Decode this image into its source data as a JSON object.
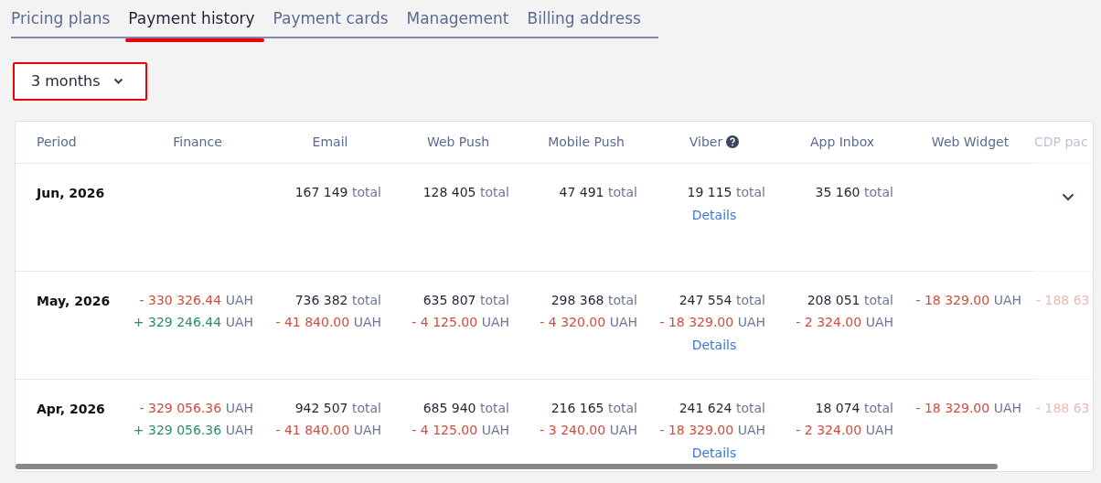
{
  "tabs": [
    {
      "label": "Pricing plans",
      "selected": false
    },
    {
      "label": "Payment history",
      "selected": true
    },
    {
      "label": "Payment cards",
      "selected": false
    },
    {
      "label": "Management",
      "selected": false
    },
    {
      "label": "Billing address",
      "selected": false
    }
  ],
  "period_select": {
    "value": "3 months"
  },
  "table": {
    "columns": [
      {
        "label": "Period"
      },
      {
        "label": "Finance"
      },
      {
        "label": "Email"
      },
      {
        "label": "Web Push"
      },
      {
        "label": "Mobile Push"
      },
      {
        "label": "Viber",
        "help": true
      },
      {
        "label": "App Inbox"
      },
      {
        "label": "Web Widget"
      },
      {
        "label": "CDP pac",
        "cut": true
      }
    ],
    "rows": [
      {
        "show_toggle": true,
        "cells": [
          "Jun, 2026",
          "",
          [
            {
              "kind": "total",
              "value": "167 149",
              "unit": "total"
            }
          ],
          [
            {
              "kind": "total",
              "value": "128 405",
              "unit": "total"
            }
          ],
          [
            {
              "kind": "total",
              "value": "47 491",
              "unit": "total"
            }
          ],
          [
            {
              "kind": "total",
              "value": "19 115",
              "unit": "total"
            },
            {
              "kind": "link",
              "text": "Details"
            }
          ],
          [
            {
              "kind": "total",
              "value": "35 160",
              "unit": "total"
            }
          ],
          "",
          ""
        ]
      },
      {
        "show_toggle": false,
        "cells": [
          "May, 2026",
          [
            {
              "kind": "debit",
              "sign": "-",
              "value": "330 326.44",
              "unit": "UAH"
            },
            {
              "kind": "credit",
              "sign": "+",
              "value": "329 246.44",
              "unit": "UAH"
            }
          ],
          [
            {
              "kind": "total",
              "value": "736 382",
              "unit": "total"
            },
            {
              "kind": "debit",
              "sign": "-",
              "value": "41 840.00",
              "unit": "UAH"
            }
          ],
          [
            {
              "kind": "total",
              "value": "635 807",
              "unit": "total"
            },
            {
              "kind": "debit",
              "sign": "-",
              "value": "4 125.00",
              "unit": "UAH"
            }
          ],
          [
            {
              "kind": "total",
              "value": "298 368",
              "unit": "total"
            },
            {
              "kind": "debit",
              "sign": "-",
              "value": "4 320.00",
              "unit": "UAH"
            }
          ],
          [
            {
              "kind": "total",
              "value": "247 554",
              "unit": "total"
            },
            {
              "kind": "debit",
              "sign": "-",
              "value": "18 329.00",
              "unit": "UAH"
            },
            {
              "kind": "link",
              "text": "Details"
            }
          ],
          [
            {
              "kind": "total",
              "value": "208 051",
              "unit": "total"
            },
            {
              "kind": "debit",
              "sign": "-",
              "value": "2 324.00",
              "unit": "UAH"
            }
          ],
          [
            {
              "kind": "debit",
              "sign": "-",
              "value": "18 329.00",
              "unit": "UAH"
            }
          ],
          [
            {
              "kind": "debit",
              "sign": "-",
              "value": "188 63"
            }
          ]
        ]
      },
      {
        "show_toggle": false,
        "cells": [
          "Apr, 2026",
          [
            {
              "kind": "debit",
              "sign": "-",
              "value": "329 056.36",
              "unit": "UAH"
            },
            {
              "kind": "credit",
              "sign": "+",
              "value": "329 056.36",
              "unit": "UAH"
            }
          ],
          [
            {
              "kind": "total",
              "value": "942 507",
              "unit": "total"
            },
            {
              "kind": "debit",
              "sign": "-",
              "value": "41 840.00",
              "unit": "UAH"
            }
          ],
          [
            {
              "kind": "total",
              "value": "685 940",
              "unit": "total"
            },
            {
              "kind": "debit",
              "sign": "-",
              "value": "4 125.00",
              "unit": "UAH"
            }
          ],
          [
            {
              "kind": "total",
              "value": "216 165",
              "unit": "total"
            },
            {
              "kind": "debit",
              "sign": "-",
              "value": "3 240.00",
              "unit": "UAH"
            }
          ],
          [
            {
              "kind": "total",
              "value": "241 624",
              "unit": "total"
            },
            {
              "kind": "debit",
              "sign": "-",
              "value": "18 329.00",
              "unit": "UAH"
            },
            {
              "kind": "link",
              "text": "Details"
            }
          ],
          [
            {
              "kind": "total",
              "value": "18 074",
              "unit": "total"
            },
            {
              "kind": "debit",
              "sign": "-",
              "value": "2 324.00",
              "unit": "UAH"
            }
          ],
          [
            {
              "kind": "debit",
              "sign": "-",
              "value": "18 329.00",
              "unit": "UAH"
            }
          ],
          [
            {
              "kind": "debit",
              "sign": "-",
              "value": "188 63"
            }
          ]
        ]
      }
    ]
  }
}
